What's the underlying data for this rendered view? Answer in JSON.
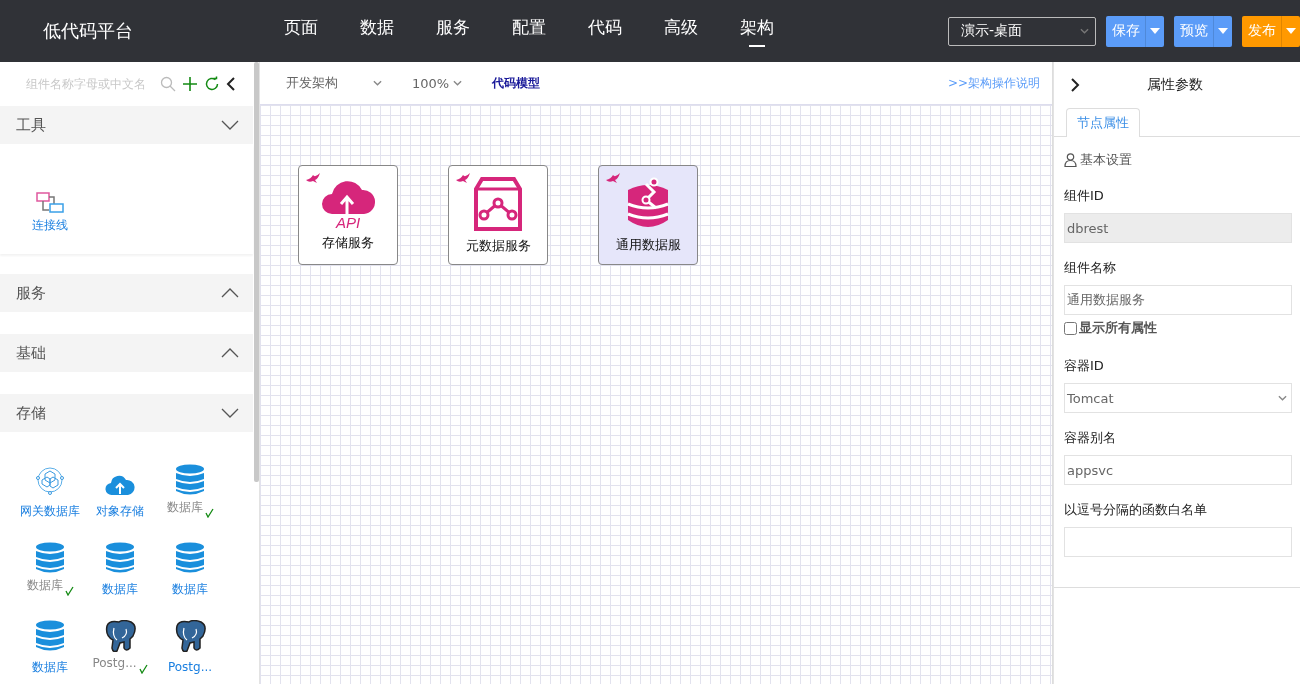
{
  "app": {
    "title": "低代码平台"
  },
  "nav_tabs": [
    {
      "label": "页面",
      "selected": false
    },
    {
      "label": "数据",
      "selected": false
    },
    {
      "label": "服务",
      "selected": false
    },
    {
      "label": "配置",
      "selected": false
    },
    {
      "label": "代码",
      "selected": false
    },
    {
      "label": "高级",
      "selected": false
    },
    {
      "label": "架构",
      "selected": true
    }
  ],
  "app_select": {
    "value": "演示-桌面"
  },
  "header_buttons": [
    {
      "label": "保存",
      "color": "#5b9cf8"
    },
    {
      "label": "预览",
      "color": "#5b9cf8"
    },
    {
      "label": "发布",
      "color": "#ff9900"
    }
  ],
  "palette": {
    "search": {
      "placeholder": "组件名称字母或中文名"
    },
    "groups": [
      {
        "title": "工具",
        "expanded": true,
        "items": [
          {
            "kind": "connector",
            "label": "连接线",
            "added": false
          }
        ]
      },
      {
        "title": "服务",
        "expanded": false
      },
      {
        "title": "基础",
        "expanded": false
      },
      {
        "title": "存储",
        "expanded": true,
        "items": [
          {
            "kind": "gateway",
            "label": "网关数据库",
            "added": false
          },
          {
            "kind": "cloud",
            "label": "对象存储",
            "added": false
          },
          {
            "kind": "database",
            "label": "数据库",
            "added": true
          },
          {
            "kind": "database",
            "label": "数据库",
            "added": true
          },
          {
            "kind": "database",
            "label": "数据库",
            "added": false
          },
          {
            "kind": "database",
            "label": "数据库",
            "added": false
          },
          {
            "kind": "database",
            "label": "数据库",
            "added": false
          },
          {
            "kind": "postgres",
            "label": "Postg...",
            "added": true
          },
          {
            "kind": "postgres",
            "label": "Postg...",
            "added": false
          }
        ]
      }
    ]
  },
  "canvas_toolbar": {
    "view": "开发架构",
    "zoom": "100%",
    "code_model": "代码模型",
    "help_link": ">>架构操作说明"
  },
  "nodes": [
    {
      "kind": "api",
      "icon_text": "API",
      "label": "存储服务",
      "selected": false
    },
    {
      "kind": "metadata",
      "label": "元数据服务",
      "selected": false
    },
    {
      "kind": "dataservice",
      "label": "通用数据服",
      "selected": true
    }
  ],
  "properties": {
    "title": "属性参数",
    "tabs": [
      {
        "label": "节点属性",
        "selected": true
      }
    ],
    "section": "基本设置",
    "fields": [
      {
        "kind": "input",
        "label": "组件ID",
        "value": "dbrest",
        "disabled": true
      },
      {
        "kind": "input",
        "label": "组件名称",
        "value": "通用数据服务",
        "disabled": false
      },
      {
        "kind": "checkbox",
        "label": "显示所有属性",
        "checked": false
      },
      {
        "kind": "select",
        "label": "容器ID",
        "value": "Tomcat"
      },
      {
        "kind": "input",
        "label": "容器别名",
        "value": "appsvc",
        "disabled": false
      },
      {
        "kind": "input",
        "label": "以逗号分隔的函数白名单",
        "disabled": false
      }
    ]
  }
}
